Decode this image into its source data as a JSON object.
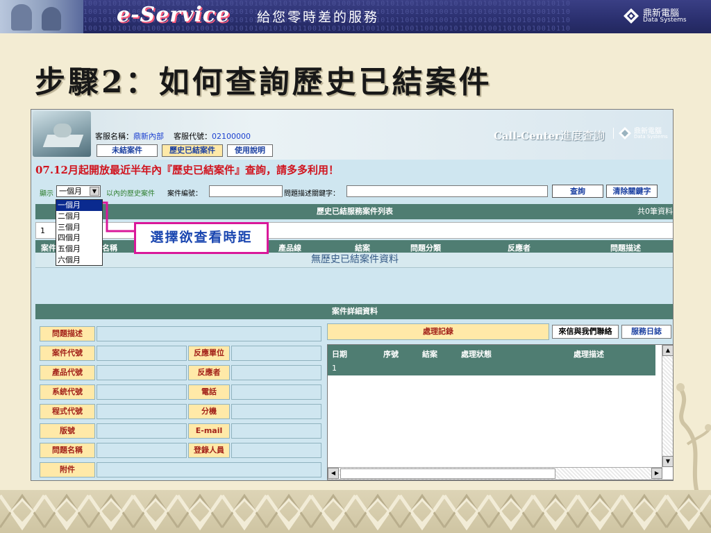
{
  "banner": {
    "logo": "e-Service",
    "slogan": "給您零時差的服務",
    "brand_name": "鼎新電腦",
    "brand_sub": "Data Systems",
    "binary": "1001010101001100101010010011010101010010101011001010100101001010110011001001011010100110101010010110"
  },
  "slide": {
    "title": "步驟2：如何查詢歷史已結案件"
  },
  "app": {
    "cs_name_label": "客服名稱：",
    "cs_name_value": "鼎新內部",
    "cs_code_label": "客服代號：",
    "cs_code_value": "02100000",
    "tabs": [
      {
        "label": "未結案件",
        "active": false
      },
      {
        "label": "歷史已結案件",
        "active": true
      },
      {
        "label": "使用說明",
        "active": false
      }
    ],
    "cc_title_en": "Call-Center",
    "cc_title_cn": "進度查詢",
    "cc_brand_name": "鼎新電腦",
    "cc_brand_sub": "Data Systems",
    "notice": "07.12月起開放最近半年內『歷史已結案件』查詢，請多多利用！"
  },
  "search": {
    "show_label": "顯示",
    "period_selected": "一個月",
    "suffix_label": "以內的歷史案件",
    "case_no_label": "案件編號：",
    "case_no_value": "",
    "keyword_label": "問題描述關鍵字：",
    "keyword_value": "",
    "query_button": "查詢",
    "clear_button": "清除關鍵字",
    "period_options": [
      "一個月",
      "二個月",
      "三個月",
      "四個月",
      "五個月",
      "六個月"
    ]
  },
  "list": {
    "title": "歷史已結服務案件列表",
    "count_text": "共0筆資料",
    "page_number": "1",
    "columns": [
      "案件",
      "名稱",
      "產品線",
      "結案",
      "問題分類",
      "反應者",
      "問題描述"
    ],
    "empty_text": "無歷史已結案件資料"
  },
  "callout": {
    "text": "選擇欲查看時距"
  },
  "detail": {
    "title": "案件詳細資料",
    "left_labels": [
      "問題描述",
      "案件代號",
      "產品代號",
      "系統代號",
      "程式代號",
      "版號",
      "問題名稱",
      "附件"
    ],
    "right_labels": [
      "反應單位",
      "反應者",
      "電話",
      "分機",
      "E-mail",
      "登錄人員"
    ],
    "log_title": "處理記錄",
    "contact_button": "來信與我們聯絡",
    "diary_button": "服務日誌",
    "log_columns": [
      "日期",
      "序號",
      "結案",
      "處理狀態",
      "處理描述"
    ],
    "log_first_row": "1"
  },
  "colors": {
    "banner": "#2a2f6e",
    "slide_bg": "#f3ecd3",
    "app_body": "#cfe6f0",
    "bar": "#4f7d72",
    "label_cell": "#ffe9a8",
    "notice_red": "#d0141e",
    "callout_border": "#d9189a"
  }
}
